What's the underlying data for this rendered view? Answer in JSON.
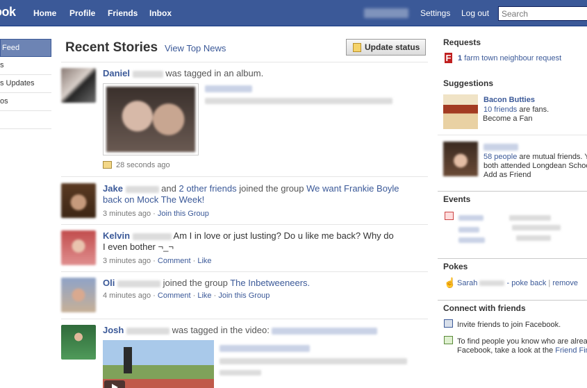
{
  "topbar": {
    "logo": "ook",
    "nav": [
      "Home",
      "Profile",
      "Friends",
      "Inbox"
    ],
    "settings": "Settings",
    "logout": "Log out",
    "search_placeholder": "Search"
  },
  "leftnav": {
    "items": [
      "Feed",
      "s",
      "s Updates",
      "os",
      ""
    ]
  },
  "main": {
    "title": "Recent Stories",
    "view_top": "View Top News",
    "update_status": "Update status",
    "stories": [
      {
        "name": "Daniel",
        "text": "was tagged in an album.",
        "time": "28 seconds ago"
      },
      {
        "name": "Jake",
        "pre": "and",
        "other": "2 other friends",
        "text": "joined the group",
        "group": "We want Frankie Boyle back on Mock The Week!",
        "time": "3 minutes ago",
        "action": "Join this Group"
      },
      {
        "name": "Kelvin",
        "text": "Am I in love or just lusting? Do u like me back? Why do I even bother ¬_¬",
        "time": "3 minutes ago",
        "comment": "Comment",
        "like": "Like"
      },
      {
        "name": "Oli",
        "text": "joined the group",
        "group": "The Inbetweeneers.",
        "time": "4 minutes ago",
        "comment": "Comment",
        "like": "Like",
        "action": "Join this Group"
      },
      {
        "name": "Josh",
        "text": "was tagged in the video:"
      }
    ]
  },
  "right": {
    "requests_head": "Requests",
    "request_count": "1",
    "request_text": "farm town neighbour request",
    "suggestions_head": "Suggestions",
    "sug1_name": "Bacon Butties",
    "sug1_friends": "10 friends",
    "sug1_fans": "are fans.",
    "sug1_action": "Become a Fan",
    "sug2_people": "58 people",
    "sug2_text": "are mutual friends. Y",
    "sug2_text2": "both attended Longdean Schoo",
    "sug2_action": "Add as Friend",
    "events_head": "Events",
    "pokes_head": "Pokes",
    "poke_name": "Sarah",
    "poke_back": "- poke back",
    "poke_sep": "|",
    "poke_remove": "remove",
    "connect_head": "Connect with friends",
    "invite_text": "Invite friends to join Facebook.",
    "find_text1": "To find people you know who are alrea",
    "find_text2": "Facebook, take a look at the",
    "find_link": "Friend Fin"
  },
  "colors": {
    "brand": "#3b5998",
    "link": "#3b5998"
  }
}
